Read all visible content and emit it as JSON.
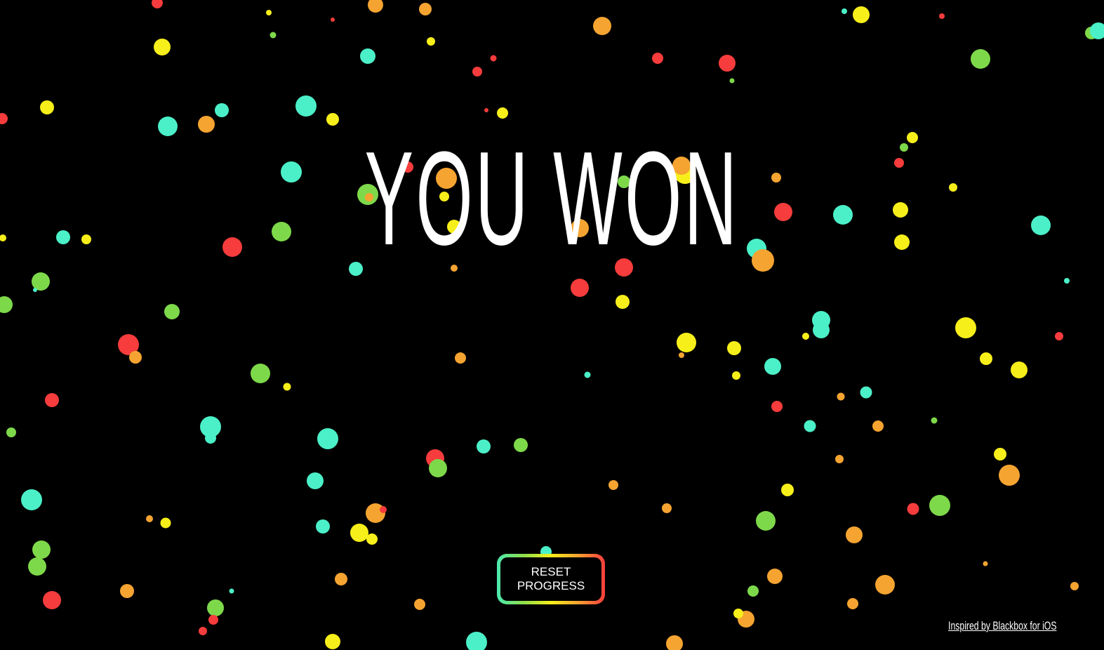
{
  "game": {
    "title": "YOU WON",
    "reset_button_line1": "RESET",
    "reset_button_line2": "PROGRESS",
    "credit_link": "Inspired by Blackbox for iOS"
  },
  "palette": {
    "background": "#000000",
    "text": "#ffffff",
    "confetti": {
      "red": "#f63c3c",
      "orange": "#f5a431",
      "yellow": "#f7ef1a",
      "green": "#7ed94a",
      "teal": "#4bf0c8"
    },
    "button_gradient": [
      "#4be8b0",
      "#8fe04a",
      "#f7ef1a",
      "#f5a431",
      "#f63c3c"
    ]
  }
}
